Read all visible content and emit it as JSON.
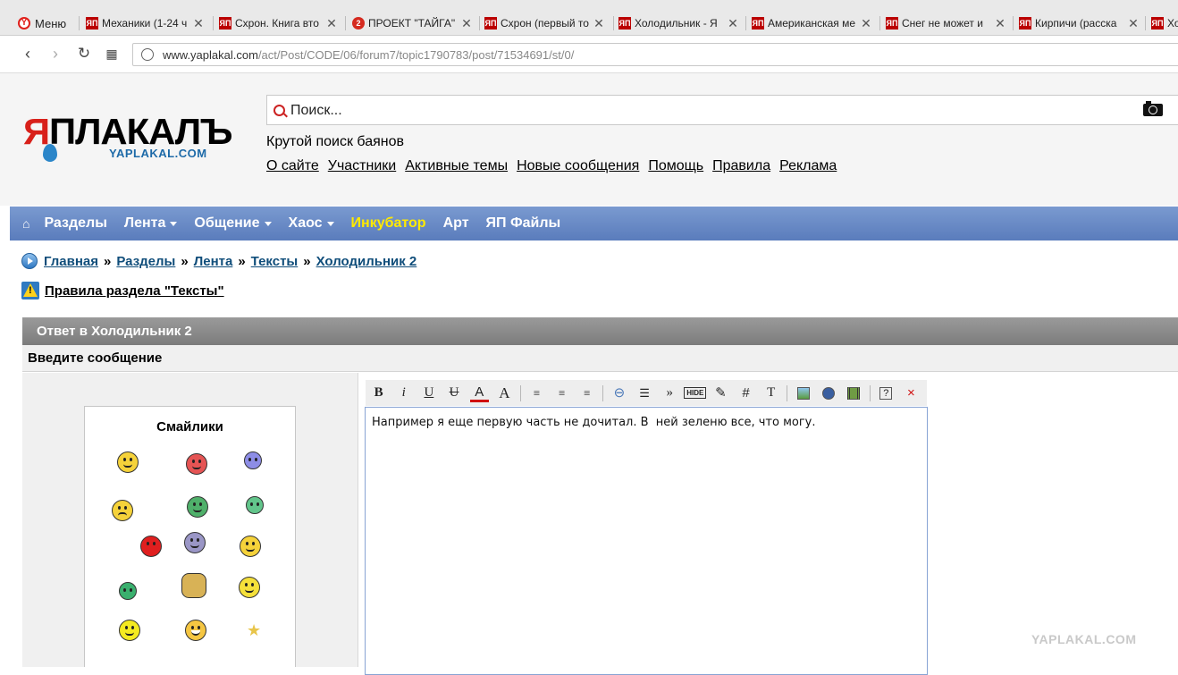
{
  "browser": {
    "menu_label": "Меню",
    "tabs": [
      {
        "title": "Механики (1-24 ч"
      },
      {
        "title": "Схрон. Книга вто"
      },
      {
        "title": "ПРОЕКТ \"ТАЙГА\""
      },
      {
        "title": "Схрон (первый то"
      },
      {
        "title": "Холодильник - Я"
      },
      {
        "title": "Американская ме"
      },
      {
        "title": "Снег не может и"
      },
      {
        "title": "Кирпичи (расска"
      },
      {
        "title": "Хо"
      }
    ],
    "url_host": "www.yaplakal.com",
    "url_path": "/act/Post/CODE/06/forum7/topic1790783/post/71534691/st/0/"
  },
  "header": {
    "logo_text": "ЯПЛАКАЛЪ",
    "logo_sub": "YAPLAKAL.COM",
    "search_placeholder": "Поиск...",
    "tagline": "Крутой поиск баянов",
    "links": [
      "О сайте",
      "Участники",
      "Активные темы",
      "Новые сообщения",
      "Помощь",
      "Правила",
      "Реклама"
    ]
  },
  "nav": {
    "items": [
      {
        "label": "Разделы"
      },
      {
        "label": "Лента"
      },
      {
        "label": "Общение"
      },
      {
        "label": "Хаос"
      },
      {
        "label": "Инкубатор"
      },
      {
        "label": "Арт"
      },
      {
        "label": "ЯП Файлы"
      }
    ],
    "highlight_color": "#ffea00"
  },
  "breadcrumb": {
    "items": [
      "Главная",
      "Разделы",
      "Лента",
      "Тексты",
      "Холодильник 2"
    ],
    "separator": "»"
  },
  "rules_link": "Правила раздела \"Тексты\"",
  "reply": {
    "title": "Ответ в Холодильник 2",
    "subtitle": "Введите сообщение",
    "smileys_title": "Смайлики",
    "message": "Например я еще первую часть не дочитал. В  ней зеленю все, что могу."
  },
  "toolbar": {
    "bold": "B",
    "italic": "i",
    "underline": "U",
    "strike": "U",
    "color": "A",
    "size": "A",
    "quote": "»",
    "hide": "HIDE",
    "hash": "#",
    "text": "T",
    "help": "?",
    "close": "×"
  },
  "watermark": "YAPLAKAL.COM"
}
